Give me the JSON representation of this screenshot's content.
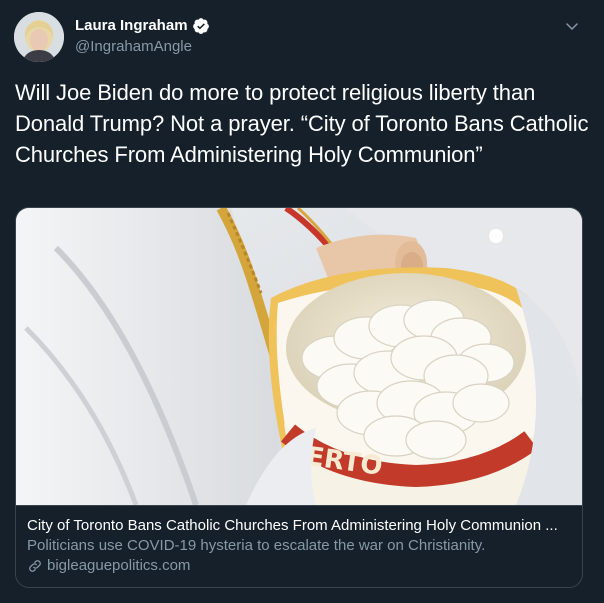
{
  "author": {
    "display_name": "Laura Ingraham",
    "handle": "@IngrahamAngle",
    "verified": true,
    "avatar_icon": "profile-photo"
  },
  "tweet": {
    "text": "Will Joe Biden do more to protect religious liberty than Donald Trump? Not a prayer. “City of Toronto Bans Catholic Churches From Administering Holy Communion”"
  },
  "card": {
    "image_icon": "communion-wafers-photo",
    "image_caption_visible_text": "ERTO",
    "title": "City of Toronto Bans Catholic Churches From Administering Holy Communion ...",
    "description": "Politicians use COVID-19 hysteria to escalate the war on Christianity.",
    "domain": "bigleaguepolitics.com",
    "link_icon": "link-icon"
  },
  "icons": {
    "verified": "verified-badge-icon",
    "menu": "chevron-down-icon"
  },
  "colors": {
    "background": "#15202b",
    "border": "#38444d",
    "secondary_text": "#8899a6",
    "primary_text": "#ffffff"
  }
}
